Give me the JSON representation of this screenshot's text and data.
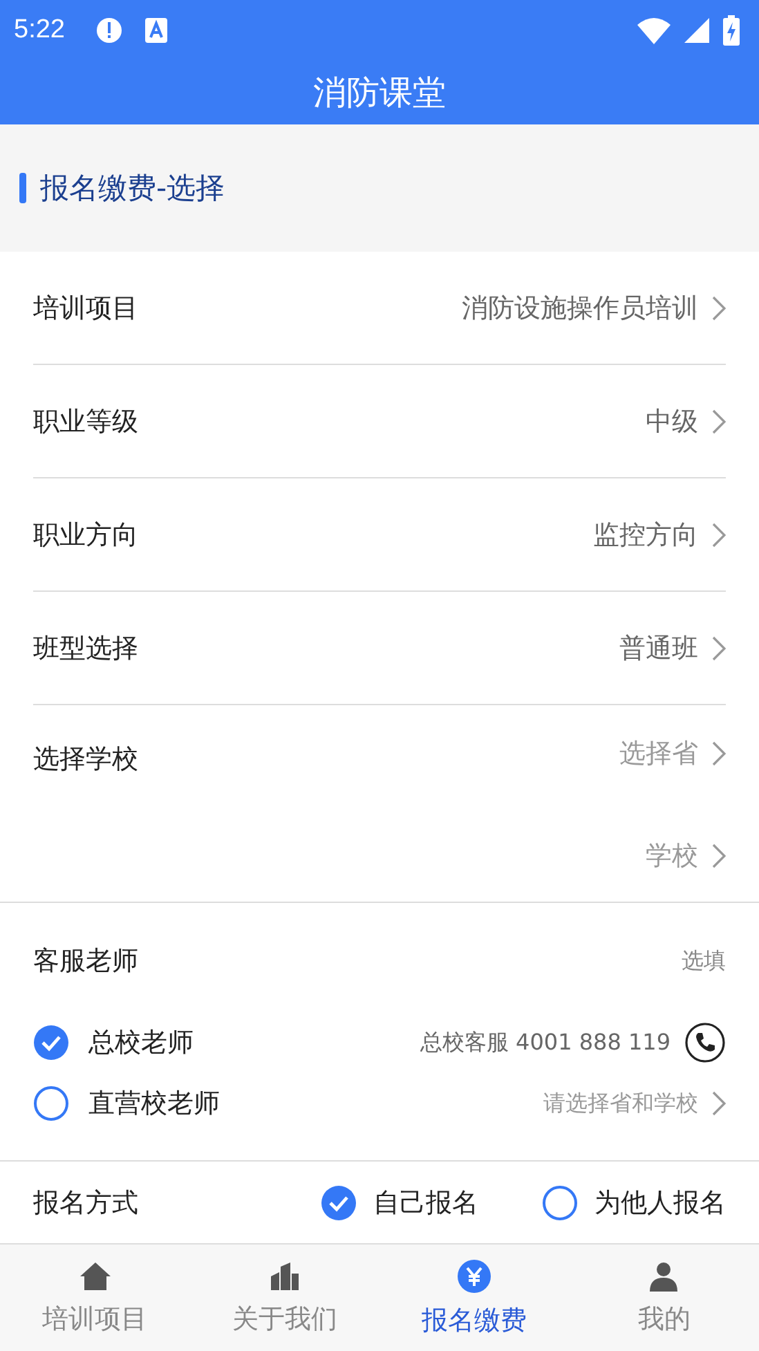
{
  "status_bar": {
    "time": "5:22"
  },
  "title": "消防课堂",
  "section": "报名缴费-选择",
  "rows": [
    {
      "label": "培训项目",
      "values": [
        {
          "text": "消防设施操作员培训",
          "filled": true
        }
      ]
    },
    {
      "label": "职业等级",
      "values": [
        {
          "text": "中级",
          "filled": true
        }
      ]
    },
    {
      "label": "职业方向",
      "values": [
        {
          "text": "监控方向",
          "filled": true
        }
      ]
    },
    {
      "label": "班型选择",
      "values": [
        {
          "text": "普通班",
          "filled": true
        }
      ]
    },
    {
      "label": "选择学校",
      "values": [
        {
          "text": "选择省",
          "filled": false
        },
        {
          "text": "学校",
          "filled": false
        }
      ]
    }
  ],
  "service": {
    "label": "客服老师",
    "hint": "选填",
    "options": [
      {
        "label": "总校老师",
        "selected": true,
        "detail": "总校客服 4001 888 119",
        "kind": "phone"
      },
      {
        "label": "直营校老师",
        "selected": false,
        "detail": "请选择省和学校",
        "kind": "chevron"
      }
    ]
  },
  "signup": {
    "label": "报名方式",
    "options": [
      {
        "label": "自己报名",
        "selected": true
      },
      {
        "label": "为他人报名",
        "selected": false
      }
    ]
  },
  "tabs": [
    {
      "label": "培训项目",
      "selected": false,
      "kind": "home"
    },
    {
      "label": "关于我们",
      "selected": false,
      "kind": "building"
    },
    {
      "label": "报名缴费",
      "selected": true,
      "kind": "payment"
    },
    {
      "label": "我的",
      "selected": false,
      "kind": "profile"
    }
  ]
}
